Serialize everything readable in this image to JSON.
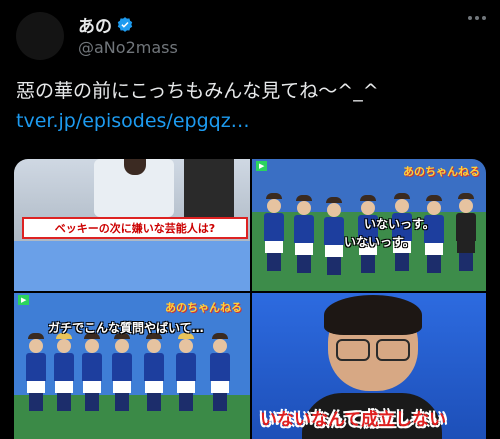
{
  "tweet": {
    "display_name": "あの",
    "handle": "@aNo2mass",
    "verified_icon": "verified-badge-icon",
    "more_icon": "more-options-icon",
    "text": "惡の華の前にこっちもみんな見てね〜^_^",
    "link": "tver.jp/episodes/epgqz…"
  },
  "media": {
    "tile1": {
      "banner_text": "ベッキーの次に嫌いな芸能人は?"
    },
    "tile2": {
      "caption1": "いないっす。",
      "caption2": "いないっす。",
      "show_logo": "あのちゃんねる"
    },
    "tile3": {
      "caption": "ガチでこんな質問やばいて…",
      "show_logo": "あのちゃんねる"
    },
    "tile4": {
      "caption": "いないなんて成立しない"
    }
  },
  "colors": {
    "background": "#000000",
    "text": "#e7e9ea",
    "secondary": "#71767b",
    "link": "#1d9bf0"
  }
}
